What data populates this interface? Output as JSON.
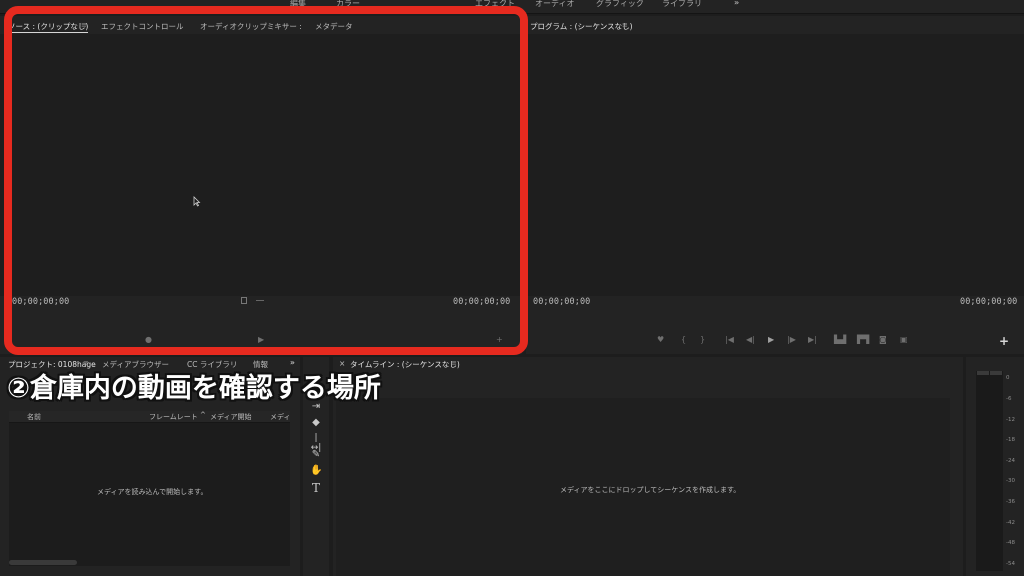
{
  "workspace_tabs": [
    "編集",
    "カラー",
    "エフェクト",
    "オーディオ",
    "グラフィック",
    "ライブラリ"
  ],
  "overflow": "»",
  "source_monitor": {
    "tabs": [
      "ソース : (クリップなし)",
      "エフェクトコントロール",
      "オーディオクリップミキサー :",
      "メタデータ"
    ],
    "menu": "≡",
    "timecode_left": "00;00;00;00",
    "timecode_right": "00;00;00;00"
  },
  "program_monitor": {
    "title": "プログラム : (シーケンスなし)",
    "menu": "≡",
    "timecode_left": "00;00;00;00",
    "timecode_right": "00;00;00;00",
    "add": "+"
  },
  "project_panel": {
    "tabs": [
      "プロジェクト: 0108hage",
      "メディアブラウザー",
      "CC ライブラリ",
      "情報"
    ],
    "overflow": "»",
    "columns": [
      "名前",
      "フレームレート",
      "メディア開始",
      "メディ"
    ],
    "empty_message": "メディアを読み込んで開始します。"
  },
  "timeline": {
    "close": "×",
    "title": "タイムライン : (シーケンスなし)",
    "menu": "≡",
    "empty_message": "メディアをここにドロップしてシーケンスを作成します。"
  },
  "audio_meter": {
    "ticks": [
      "0",
      "-6",
      "-12",
      "-18",
      "-24",
      "-30",
      "-36",
      "-42",
      "-48",
      "-54"
    ]
  },
  "annotation": "②倉庫内の動画を確認する場所",
  "colors": {
    "highlight": "#e62a1f",
    "background": "#1d1d1d",
    "panel": "#232323"
  }
}
